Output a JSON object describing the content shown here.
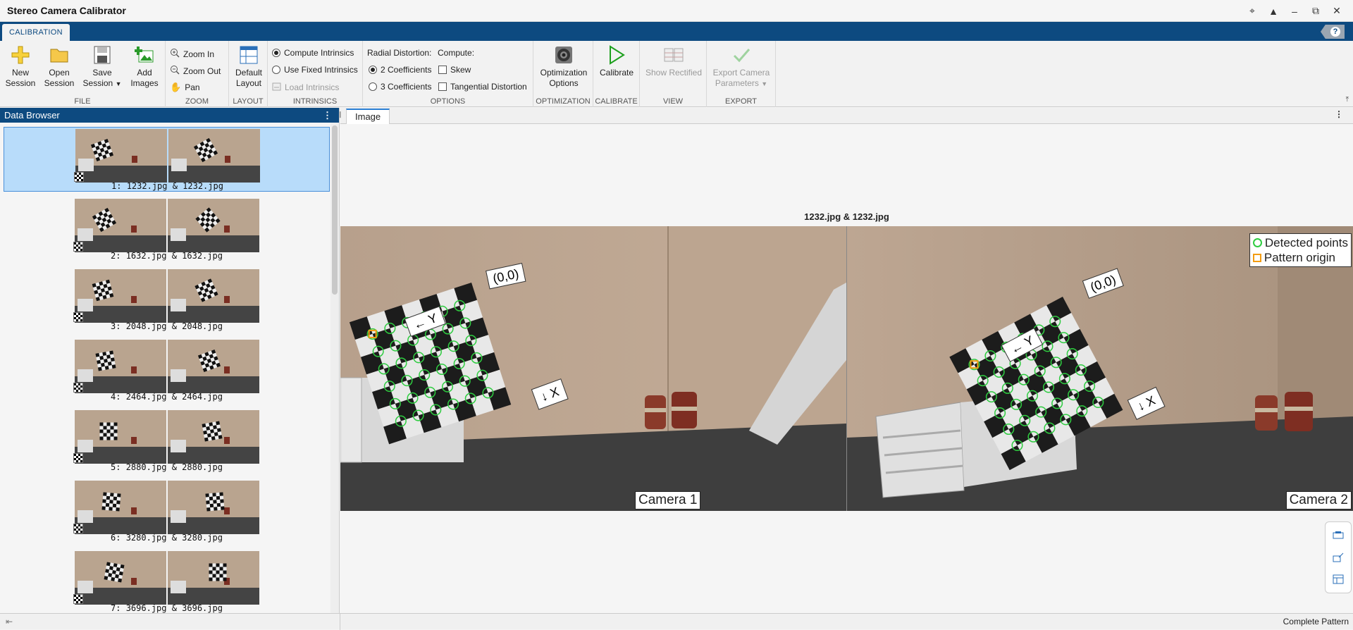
{
  "window": {
    "title": "Stereo Camera Calibrator",
    "controls": [
      "pin-icon",
      "collapse-ribbon-icon",
      "minimize-icon",
      "restore-icon",
      "close-icon"
    ]
  },
  "ribbon": {
    "tab_label": "CALIBRATION",
    "help_label": "?",
    "file": {
      "label": "FILE",
      "new_session": "New Session",
      "new_session_l1": "New",
      "new_session_l2": "Session",
      "open_session_l1": "Open",
      "open_session_l2": "Session",
      "save_session_l1": "Save",
      "save_session_l2": "Session",
      "add_images_l1": "Add",
      "add_images_l2": "Images"
    },
    "zoom": {
      "label": "ZOOM",
      "zoom_in": "Zoom In",
      "zoom_out": "Zoom Out",
      "pan": "Pan"
    },
    "layout": {
      "label": "LAYOUT",
      "default_l1": "Default",
      "default_l2": "Layout"
    },
    "intrinsics": {
      "label": "INTRINSICS",
      "compute": "Compute Intrinsics",
      "use_fixed": "Use Fixed Intrinsics",
      "load": "Load Intrinsics",
      "selected": "compute"
    },
    "options": {
      "label": "OPTIONS",
      "radial_label": "Radial Distortion:",
      "compute_label": "Compute:",
      "two_coeff": "2 Coefficients",
      "three_coeff": "3 Coefficients",
      "skew": "Skew",
      "tangential": "Tangential Distortion",
      "selected_radial": "2"
    },
    "optimization": {
      "label": "OPTIMIZATION",
      "btn_l1": "Optimization",
      "btn_l2": "Options"
    },
    "calibrate": {
      "label": "CALIBRATE",
      "btn": "Calibrate"
    },
    "view": {
      "label": "VIEW",
      "btn": "Show Rectified"
    },
    "export": {
      "label": "EXPORT",
      "btn_l1": "Export Camera",
      "btn_l2": "Parameters"
    }
  },
  "data_browser": {
    "title": "Data Browser",
    "items": [
      {
        "label": "1: 1232.jpg & 1232.jpg",
        "selected": true
      },
      {
        "label": "2: 1632.jpg & 1632.jpg",
        "selected": false
      },
      {
        "label": "3: 2048.jpg & 2048.jpg",
        "selected": false
      },
      {
        "label": "4: 2464.jpg & 2464.jpg",
        "selected": false
      },
      {
        "label": "5: 2880.jpg & 2880.jpg",
        "selected": false
      },
      {
        "label": "6: 3280.jpg & 3280.jpg",
        "selected": false
      },
      {
        "label": "7: 3696.jpg & 3696.jpg",
        "selected": false
      }
    ]
  },
  "image_panel": {
    "tab": "Image",
    "title": "1232.jpg & 1232.jpg",
    "camera1": "Camera 1",
    "camera2": "Camera 2",
    "origin_label": "(0,0)",
    "y_label": "← Y",
    "x_label": "↓ X",
    "legend_detected": "Detected points",
    "legend_origin": "Pattern origin",
    "colors": {
      "detected": "#2ecc40",
      "origin": "#f39c12",
      "accent": "#0d4a80"
    }
  },
  "status": {
    "right": "Complete Pattern"
  }
}
